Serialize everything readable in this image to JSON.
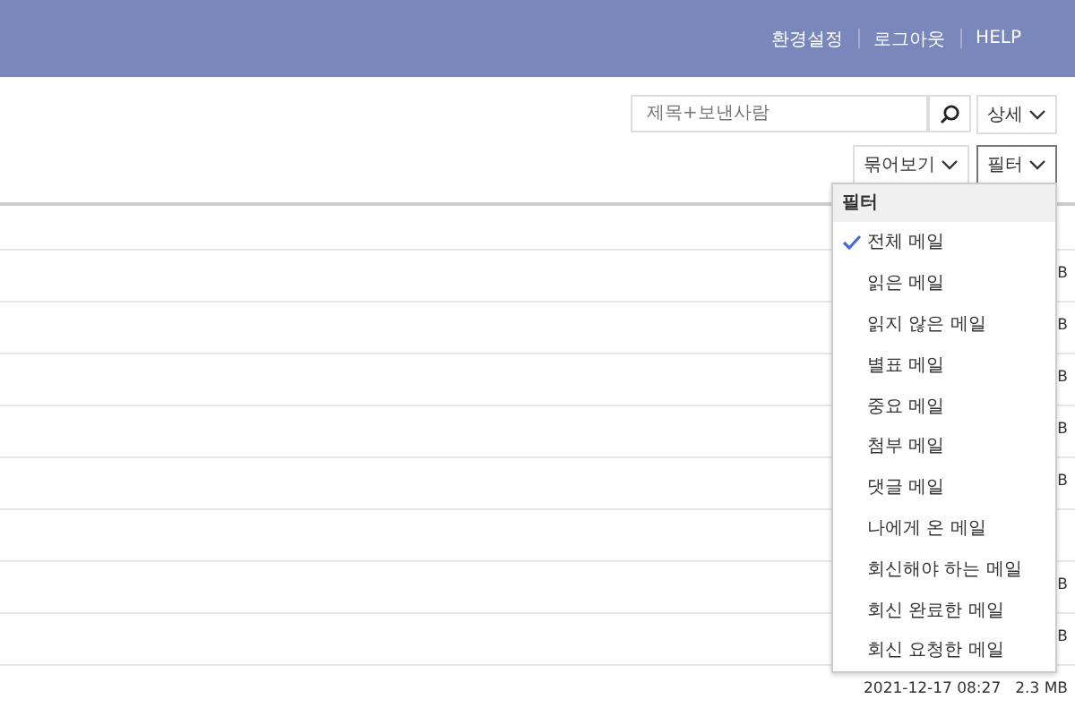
{
  "header": {
    "links": [
      "환경설정",
      "로그아웃",
      "HELP"
    ]
  },
  "search": {
    "placeholder": "제목+보낸사람"
  },
  "detail_button": "상세",
  "group_button": "묶어보기",
  "filter_button": {
    "label": "필터",
    "selected": true
  },
  "rows": [
    {
      "size": "B"
    },
    {
      "size": "B"
    },
    {
      "size": "B"
    },
    {
      "size": "B"
    },
    {
      "size": "B"
    },
    {},
    {
      "size": "B"
    },
    {
      "size": "B"
    },
    {
      "date": "2021-12-17 08:27",
      "size": "2.3 MB"
    }
  ],
  "filter_menu": {
    "title": "필터",
    "items": [
      {
        "label": "전체 메일",
        "selected": true
      },
      {
        "label": "읽은 메일",
        "selected": false
      },
      {
        "label": "읽지 않은 메일",
        "selected": false
      },
      {
        "label": "별표 메일",
        "selected": false
      },
      {
        "label": "중요 메일",
        "selected": false
      },
      {
        "label": "첨부 메일",
        "selected": false
      },
      {
        "label": "댓글 메일",
        "selected": false
      },
      {
        "label": "나에게 온 메일",
        "selected": false
      },
      {
        "label": "회신해야 하는 메일",
        "selected": false
      },
      {
        "label": "회신 완료한 메일",
        "selected": false
      },
      {
        "label": "회신 요청한 메일",
        "selected": false
      }
    ]
  }
}
